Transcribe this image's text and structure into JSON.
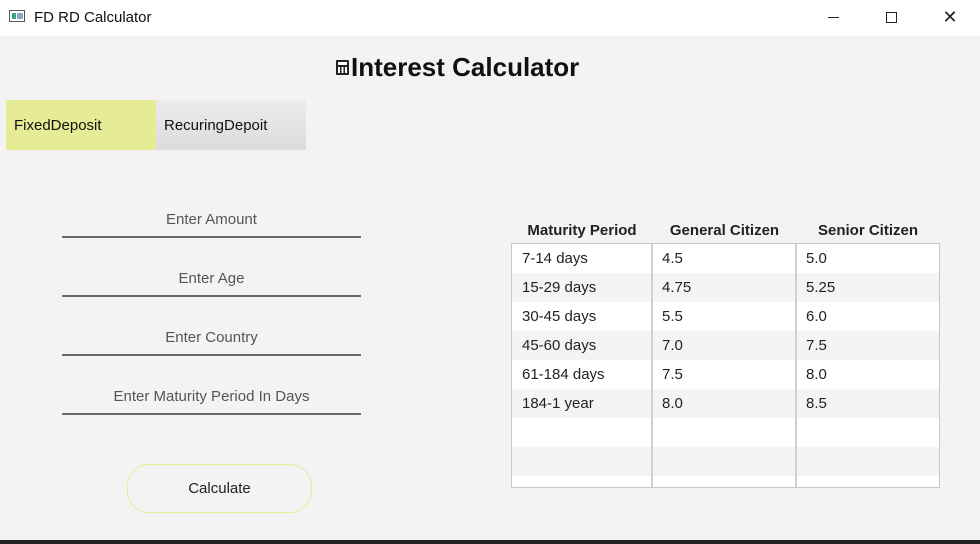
{
  "window": {
    "title": "FD RD Calculator",
    "minimize_label": "",
    "maximize_label": "",
    "close_label": "✕"
  },
  "header": {
    "title": "Interest Calculator"
  },
  "tabs": [
    {
      "label": "FixedDeposit",
      "selected": true
    },
    {
      "label": "RecuringDepoit",
      "selected": false
    }
  ],
  "form": {
    "amount_placeholder": "Enter Amount",
    "age_placeholder": "Enter Age",
    "country_placeholder": "Enter Country",
    "maturity_placeholder": "Enter Maturity Period In Days",
    "calculate_label": "Calculate"
  },
  "table": {
    "columns": [
      "Maturity Period",
      "General Citizen",
      "Senior Citizen"
    ],
    "rows": [
      [
        "7-14 days",
        "4.5",
        "5.0"
      ],
      [
        "15-29 days",
        "4.75",
        "5.25"
      ],
      [
        "30-45 days",
        "5.5",
        "6.0"
      ],
      [
        "45-60 days",
        "7.0",
        "7.5"
      ],
      [
        "61-184 days",
        "7.5",
        "8.0"
      ],
      [
        "184-1 year",
        "8.0",
        "8.5"
      ]
    ]
  },
  "colors": {
    "accent": "#e6ec96",
    "background": "#f3f3f3"
  }
}
